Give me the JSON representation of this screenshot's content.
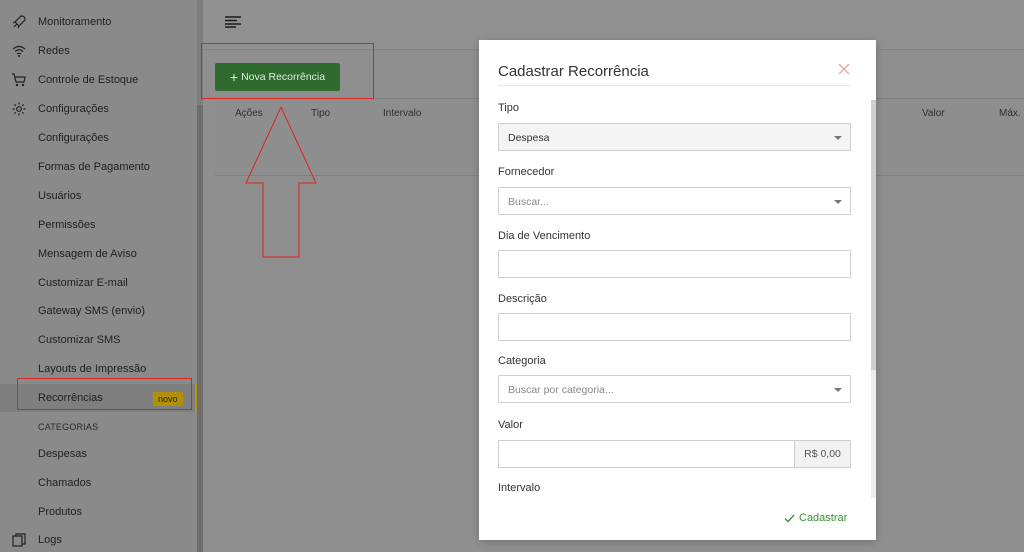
{
  "sidebar": {
    "items": [
      {
        "label": "Monitoramento",
        "icon": "rocket-icon"
      },
      {
        "label": "Redes",
        "icon": "wifi-icon"
      },
      {
        "label": "Controle de Estoque",
        "icon": "cart-icon"
      },
      {
        "label": "Configurações",
        "icon": "gear-icon"
      },
      {
        "label": "Configurações"
      },
      {
        "label": "Formas de Pagamento"
      },
      {
        "label": "Usuários"
      },
      {
        "label": "Permissões"
      },
      {
        "label": "Mensagem de Aviso"
      },
      {
        "label": "Customizar E-mail"
      },
      {
        "label": "Gateway SMS (envio)"
      },
      {
        "label": "Customizar SMS"
      },
      {
        "label": "Layouts de Impressão"
      },
      {
        "label": "Recorrências",
        "badge": "novo",
        "active": true
      },
      {
        "label": "CATEGORIAS",
        "section": true
      },
      {
        "label": "Despesas"
      },
      {
        "label": "Chamados"
      },
      {
        "label": "Produtos"
      },
      {
        "label": "Logs",
        "icon": "copy-icon"
      }
    ]
  },
  "toolbar": {
    "new_button_label": "Nova Recorrência"
  },
  "table": {
    "columns": [
      "Ações",
      "Tipo",
      "Intervalo",
      "Valor",
      "Máx."
    ]
  },
  "modal": {
    "title": "Cadastrar Recorrência",
    "fields": {
      "tipo": {
        "label": "Tipo",
        "value": "Despesa"
      },
      "fornecedor": {
        "label": "Fornecedor",
        "placeholder": "Buscar..."
      },
      "dia_vencimento": {
        "label": "Dia de Vencimento",
        "value": ""
      },
      "descricao": {
        "label": "Descrição",
        "value": ""
      },
      "categoria": {
        "label": "Categoria",
        "placeholder": "Buscar por categoria..."
      },
      "valor": {
        "label": "Valor",
        "value": "",
        "addon": "R$ 0,00"
      },
      "intervalo": {
        "label": "Intervalo"
      }
    },
    "submit_label": "Cadastrar"
  },
  "colors": {
    "accent_green": "#3b8f3b",
    "button_green": "#2f6b2f",
    "badge_yellow": "#b38f07",
    "annotation_red": "#dd2222"
  }
}
